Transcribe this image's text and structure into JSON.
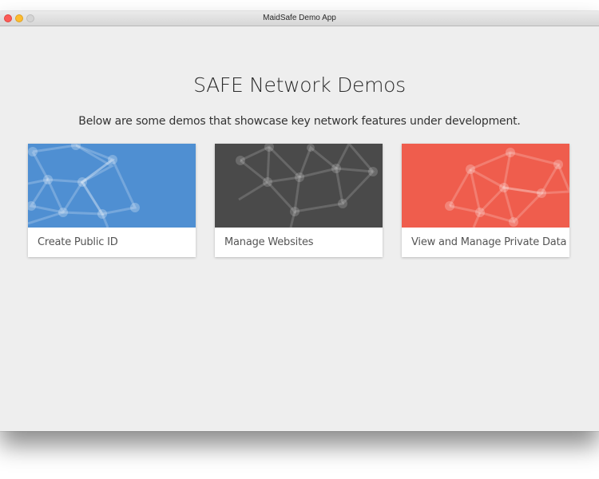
{
  "window": {
    "title": "MaidSafe Demo App"
  },
  "main": {
    "title": "SAFE Network Demos",
    "subtitle": "Below are some demos that showcase key network features under development."
  },
  "cards": [
    {
      "label": "Create Public ID",
      "color": "#4f8fd2",
      "icon": "network-graph-icon"
    },
    {
      "label": "Manage Websites",
      "color": "#4a4a4a",
      "icon": "network-graph-icon"
    },
    {
      "label": "View and Manage Private Data",
      "color": "#ef5d4d",
      "icon": "network-graph-icon"
    }
  ],
  "colors": {
    "background": "#eeeeee",
    "card_background": "#ffffff"
  }
}
